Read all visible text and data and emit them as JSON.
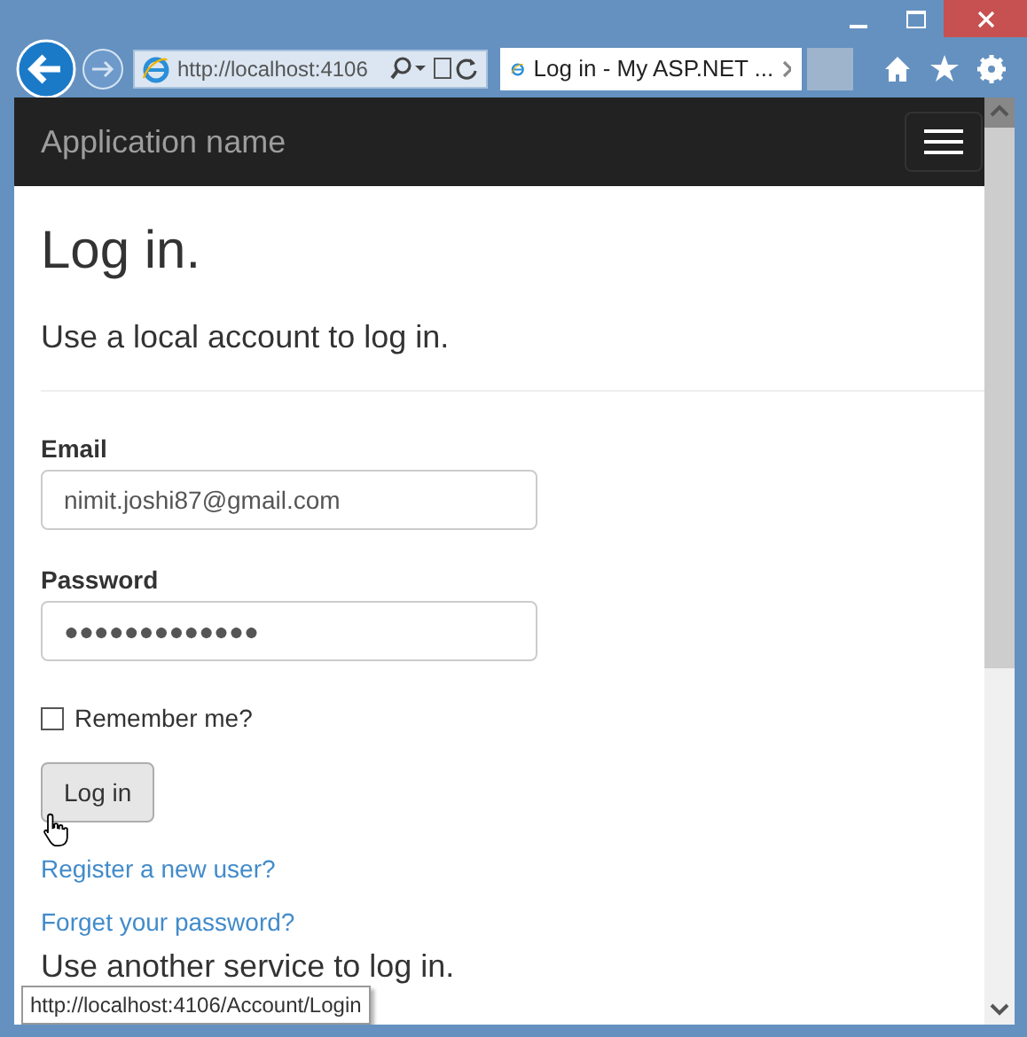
{
  "browser": {
    "address": "http://localhost:4106",
    "tab_title": "Log in - My ASP.NET ..."
  },
  "navbar": {
    "brand": "Application name"
  },
  "page": {
    "heading": "Log in.",
    "subheading": "Use a local account to log in.",
    "fields": [
      {
        "label": "Email",
        "value": "nimit.joshi87@gmail.com"
      },
      {
        "label": "Password",
        "value": "●●●●●●●●●●●●●"
      }
    ],
    "remember": {
      "label": "Remember me?",
      "checked": false
    },
    "submit": "Log in",
    "links": [
      "Register a new user?",
      "Forget your password?"
    ],
    "other_heading": "Use another service to log in."
  },
  "status_bar": {
    "url": "http://localhost:4106/Account/Login"
  }
}
